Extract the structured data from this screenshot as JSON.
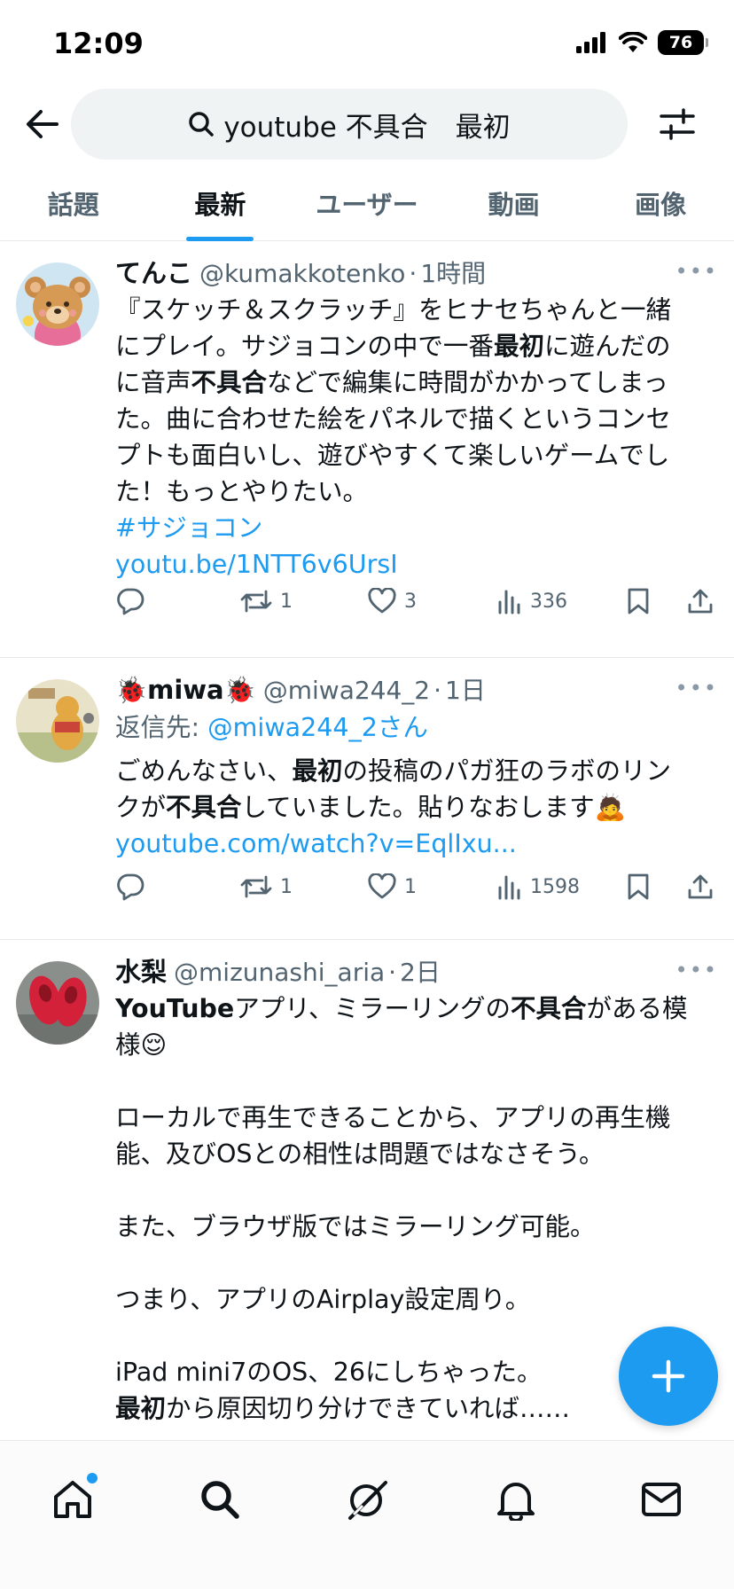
{
  "status_bar": {
    "time": "12:09",
    "battery": "76"
  },
  "search": {
    "query": "youtube 不具合　最初"
  },
  "tabs": [
    {
      "label": "話題",
      "active": false
    },
    {
      "label": "最新",
      "active": true
    },
    {
      "label": "ユーザー",
      "active": false
    },
    {
      "label": "動画",
      "active": false
    },
    {
      "label": "画像",
      "active": false
    }
  ],
  "tweets": [
    {
      "name": "てんこ",
      "handle": "@kumakkotenko",
      "time": "1時間",
      "text_lines": [
        [
          "『スケッチ＆スクラッチ』をヒナセちゃんと一緒"
        ],
        [
          "にプレイ。サジョコンの中で一番",
          {
            "b": "最初"
          },
          "に遊んだの"
        ],
        [
          "に音声",
          {
            "b": "不具合"
          },
          "などで編集に時間がかかってしまっ"
        ],
        [
          "た。曲に合わせた絵をパネルで描くというコンセ"
        ],
        [
          "プトも面白いし、遊びやすくて楽しいゲームでし"
        ],
        [
          "た！もっとやりたい。"
        ]
      ],
      "hashtag": "#サジョコン",
      "link": "youtu.be/1NTT6v6UrsI",
      "stats": {
        "replies": "",
        "retweets": "1",
        "likes": "3",
        "views": "336"
      }
    },
    {
      "name_prefix_emoji": "🐞",
      "name": "miwa",
      "name_suffix_emoji": "🐞",
      "handle": "@miwa244_2",
      "time": "1日",
      "reply_to_label": "返信先: ",
      "reply_to_handle": "@miwa244_2さん",
      "text_lines": [
        [
          "ごめんなさい、",
          {
            "b": "最初"
          },
          "の投稿のパガ狂のラボのリン"
        ],
        [
          "クが",
          {
            "b": "不具合"
          },
          "していました。貼りなおします🙇"
        ]
      ],
      "link": "youtube.com/watch?v=EqlIxu...",
      "stats": {
        "replies": "",
        "retweets": "1",
        "likes": "1",
        "views": "1598"
      }
    },
    {
      "name": "水梨",
      "handle": "@mizunashi_aria",
      "time": "2日",
      "text_lines": [
        [
          {
            "b": "YouTube"
          },
          "アプリ、ミラーリングの",
          {
            "b": "不具合"
          },
          "がある模"
        ],
        [
          "様😌"
        ],
        [
          ""
        ],
        [
          "ローカルで再生できることから、アプリの再生機"
        ],
        [
          "能、及びOSとの相性は問題ではなさそう。"
        ],
        [
          ""
        ],
        [
          "また、ブラウザ版ではミラーリング可能。"
        ],
        [
          ""
        ],
        [
          "つまり、アプリのAirplay設定周り。"
        ],
        [
          ""
        ],
        [
          "iPad mini7のOS、26にしちゃった。"
        ],
        [
          {
            "b": "最初"
          },
          "から原因切り分けできていれば……"
        ]
      ]
    }
  ],
  "more_label": "•••",
  "colors": {
    "accent": "#1d9bf0",
    "text_primary": "#0f1419",
    "text_secondary": "#536471",
    "divider": "#e6e9ea"
  },
  "nav": [
    {
      "icon": "home-icon",
      "has_badge": true
    },
    {
      "icon": "search-icon"
    },
    {
      "icon": "grok-icon"
    },
    {
      "icon": "bell-icon"
    },
    {
      "icon": "mail-icon"
    }
  ]
}
